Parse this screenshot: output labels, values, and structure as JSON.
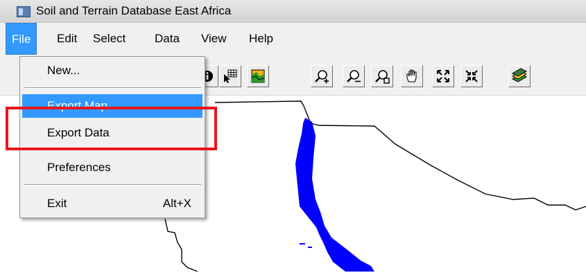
{
  "window": {
    "title": "Soil and Terrain Database East Africa"
  },
  "menubar": {
    "items": [
      "File",
      "Edit",
      "Select",
      "Data",
      "View",
      "Help"
    ]
  },
  "file_menu": {
    "new": "New...",
    "export_map": "Export Map",
    "export_data": "Export Data",
    "preferences": "Preferences",
    "exit": "Exit",
    "exit_shortcut": "Alt+X"
  },
  "toolbar": {
    "icons": [
      "info-icon",
      "table-cursor-icon",
      "map-layer-icon",
      "zoom-in-icon",
      "zoom-out-icon",
      "zoom-select-icon",
      "pan-hand-icon",
      "full-extent-icon",
      "zoom-previous-icon",
      "layers-icon"
    ]
  },
  "colors": {
    "menu_highlight": "#3399ff",
    "annotation_box": "#e8141c",
    "water_feature": "#0000ff"
  }
}
